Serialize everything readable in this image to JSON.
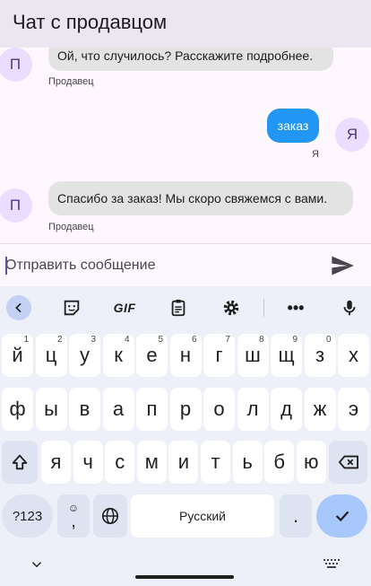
{
  "appbar": {
    "title": "Чат с продавцом"
  },
  "messages": [
    {
      "side": "in",
      "avatar": "П",
      "text": "Ой, что случилось? Расскажите подробнее.",
      "sender": "Продавец"
    },
    {
      "side": "out",
      "avatar": "Я",
      "text": "заказ",
      "sender": "Я"
    },
    {
      "side": "in",
      "avatar": "П",
      "text": "Спасибо за заказ! Мы скоро свяжемся с вами.",
      "sender": "Продавец"
    }
  ],
  "input": {
    "placeholder": "Отправить сообщение"
  },
  "keyboard": {
    "toolbar": {
      "gif": "GIF",
      "more": "•••"
    },
    "row1": [
      {
        "k": "й",
        "hint": "1"
      },
      {
        "k": "ц",
        "hint": "2"
      },
      {
        "k": "у",
        "hint": "3"
      },
      {
        "k": "к",
        "hint": "4"
      },
      {
        "k": "е",
        "hint": "5"
      },
      {
        "k": "н",
        "hint": "6"
      },
      {
        "k": "г",
        "hint": "7"
      },
      {
        "k": "ш",
        "hint": "8"
      },
      {
        "k": "щ",
        "hint": "9"
      },
      {
        "k": "з",
        "hint": "0"
      },
      {
        "k": "х",
        "hint": ""
      }
    ],
    "row2": [
      "ф",
      "ы",
      "в",
      "а",
      "п",
      "р",
      "о",
      "л",
      "д",
      "ж",
      "э"
    ],
    "row3": [
      "я",
      "ч",
      "с",
      "м",
      "и",
      "т",
      "ь",
      "б",
      "ю"
    ],
    "bottom": {
      "symbols": "?123",
      "comma": ",",
      "space": "Русский",
      "period": "."
    }
  },
  "colors": {
    "accent": "#6750a4",
    "bubble_out": "#2196f3",
    "bubble_in": "#e3e3e3",
    "enter": "#a8c7fa"
  }
}
